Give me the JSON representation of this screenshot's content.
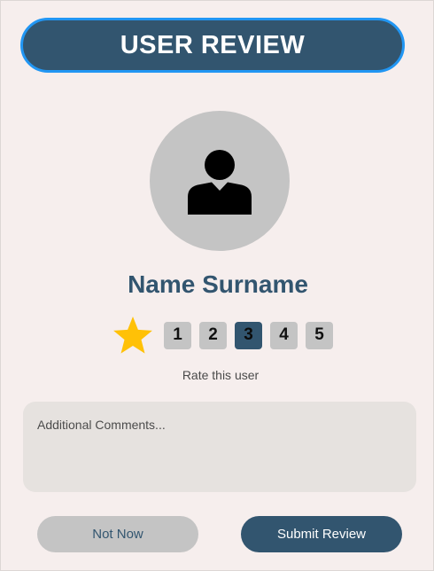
{
  "header": {
    "title": "USER REVIEW"
  },
  "profile": {
    "name": "Name Surname",
    "avatar_icon": "user-silhouette-icon"
  },
  "rating": {
    "icon": "star-icon",
    "options": [
      "1",
      "2",
      "3",
      "4",
      "5"
    ],
    "selected": "3",
    "label": "Rate this user"
  },
  "comments": {
    "placeholder": "Additional Comments...",
    "value": ""
  },
  "actions": {
    "secondary_label": "Not Now",
    "primary_label": "Submit Review"
  },
  "colors": {
    "primary": "#32556f",
    "header_border": "#2196f3",
    "background": "#f6eeed",
    "neutral": "#c4c4c4",
    "star": "#ffc107"
  }
}
